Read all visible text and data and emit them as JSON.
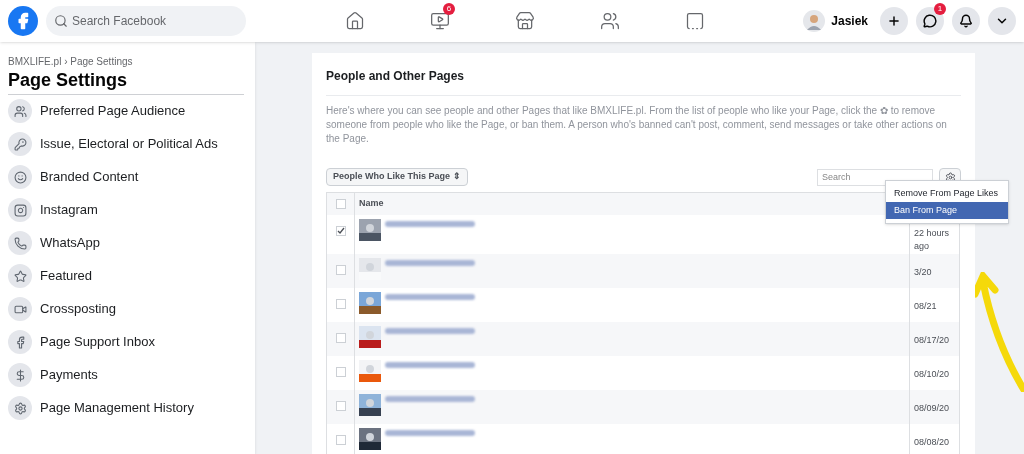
{
  "topbar": {
    "search": {
      "placeholder": "Search Facebook"
    },
    "nav": [
      {
        "kind": "home",
        "selected": false
      },
      {
        "kind": "video",
        "selected": false,
        "badge": "6"
      },
      {
        "kind": "store",
        "selected": false
      },
      {
        "kind": "groups",
        "selected": false
      },
      {
        "kind": "gaming",
        "selected": false
      }
    ],
    "user": {
      "name": "Jasiek"
    },
    "actions": [
      {
        "kind": "plus"
      },
      {
        "kind": "messenger",
        "badge": "1"
      },
      {
        "kind": "bell"
      },
      {
        "kind": "caret"
      }
    ]
  },
  "sidebar": {
    "breadcrumb": "BMXLIFE.pl › Page Settings",
    "title": "Page Settings",
    "items": [
      {
        "label": "Preferred Page Audience",
        "kind": "audience"
      },
      {
        "label": "Issue, Electoral or Political Ads",
        "kind": "ads"
      },
      {
        "label": "Branded Content",
        "kind": "branded"
      },
      {
        "label": "Instagram",
        "kind": "instagram"
      },
      {
        "label": "WhatsApp",
        "kind": "whatsapp"
      },
      {
        "label": "Featured",
        "kind": "star"
      },
      {
        "label": "Crossposting",
        "kind": "video"
      },
      {
        "label": "Page Support Inbox",
        "kind": "facebook"
      },
      {
        "label": "Payments",
        "kind": "dollar"
      },
      {
        "label": "Page Management History",
        "kind": "gear"
      }
    ]
  },
  "panel": {
    "title": "People and Other Pages",
    "description": "Here's where you can see people and other Pages that like BMXLIFE.pl. From the list of people who like your Page, click the ✿ to remove someone from people who like the Page, or ban them. A person who's banned can't post, comment, send messages or take other actions on the Page.",
    "filter": "People Who Like This Page ⇕",
    "search": {
      "placeholder": "Search"
    },
    "menu": [
      {
        "label": "Remove From Page Likes",
        "selected": false
      },
      {
        "label": "Ban From Page",
        "selected": true
      }
    ],
    "table": {
      "columns": [
        "Name"
      ],
      "all_checked": false,
      "rows": [
        {
          "checked": true,
          "date": "22 hours ago"
        },
        {
          "checked": false,
          "date": "3/20"
        },
        {
          "checked": false,
          "date": "08/21"
        },
        {
          "checked": false,
          "date": "08/17/20"
        },
        {
          "checked": false,
          "date": "08/10/20"
        },
        {
          "checked": false,
          "date": "08/09/20"
        },
        {
          "checked": false,
          "date": "08/08/20"
        }
      ]
    }
  }
}
